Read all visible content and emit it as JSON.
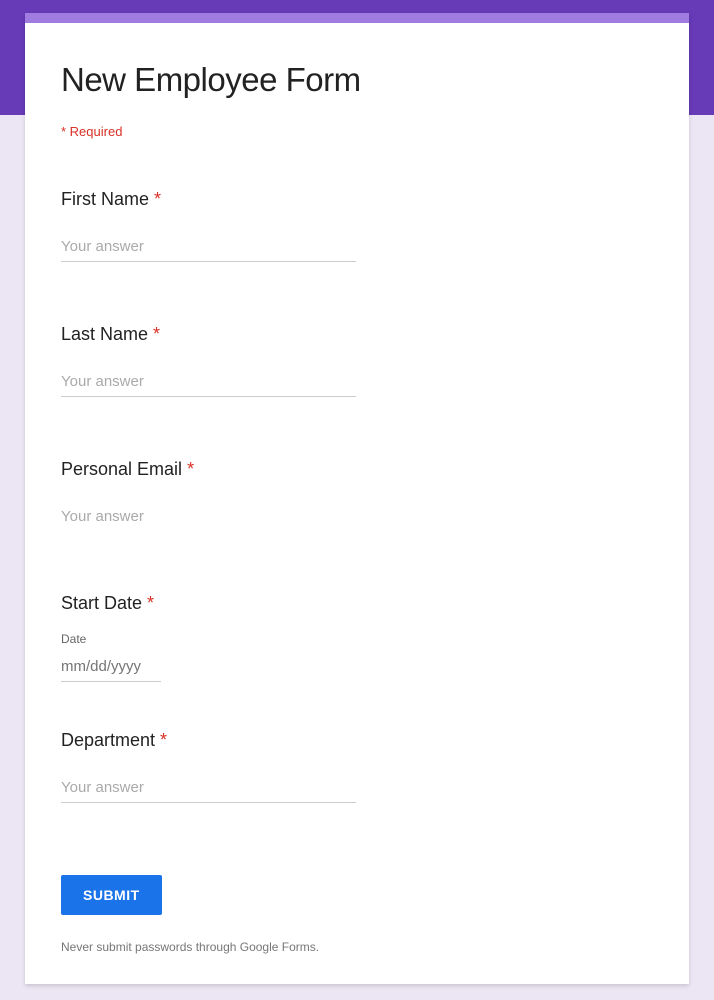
{
  "form": {
    "title": "New Employee Form",
    "required_note": "* Required",
    "questions": [
      {
        "label": "First Name",
        "placeholder": "Your answer",
        "required": true,
        "type": "text"
      },
      {
        "label": "Last Name",
        "placeholder": "Your answer",
        "required": true,
        "type": "text"
      },
      {
        "label": "Personal Email",
        "placeholder": "Your answer",
        "required": true,
        "type": "email"
      },
      {
        "label": "Start Date",
        "sublabel": "Date",
        "placeholder": "mm/dd/yyyy",
        "required": true,
        "type": "date"
      },
      {
        "label": "Department",
        "placeholder": "Your answer",
        "required": true,
        "type": "text"
      }
    ],
    "submit_label": "SUBMIT",
    "footer_note": "Never submit passwords through Google Forms.",
    "asterisk": " *"
  }
}
